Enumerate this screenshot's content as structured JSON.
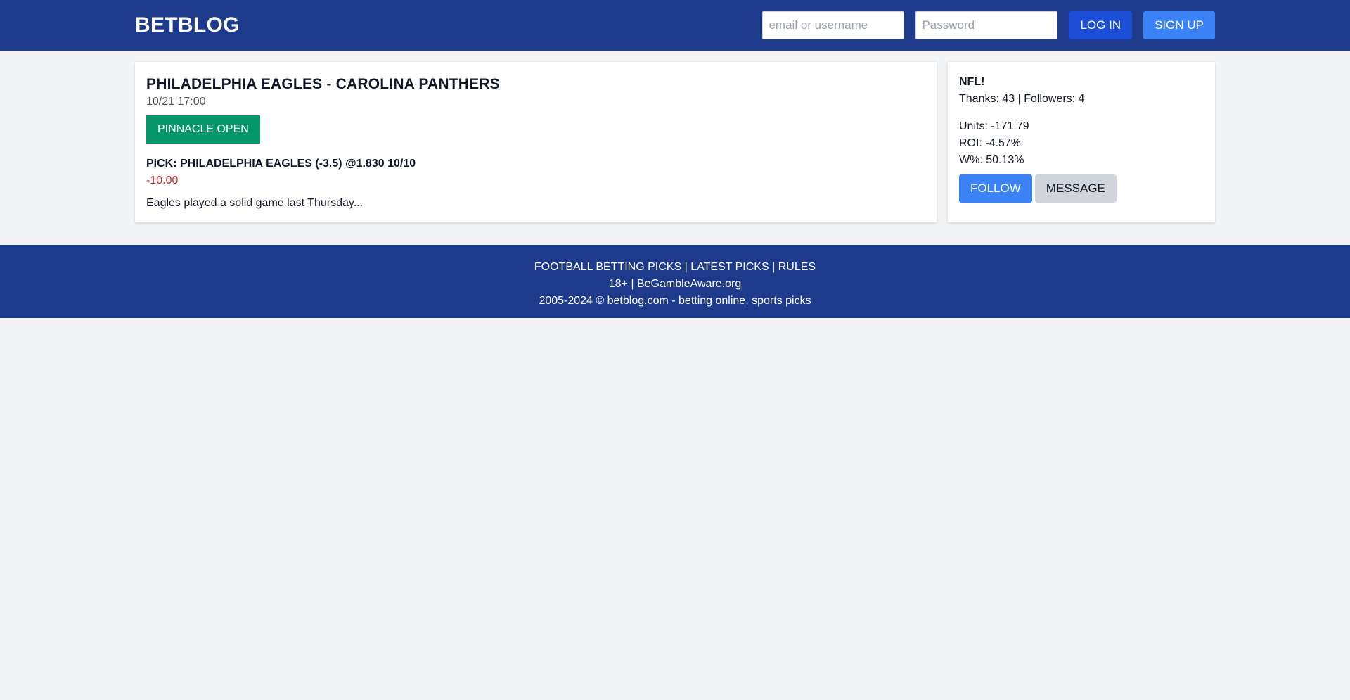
{
  "header": {
    "logo": "BETBLOG",
    "username_placeholder": "email or username",
    "password_placeholder": "Password",
    "login_label": "LOG IN",
    "signup_label": "SIGN UP"
  },
  "pick": {
    "match_title": "PHILADELPHIA EAGLES - CAROLINA PANTHERS",
    "datetime": "10/21 17:00",
    "odds_button_label": "PINNACLE OPEN",
    "pick_line": "PICK: PHILADELPHIA EAGLES (-3.5) @1.830 10/10",
    "result": "-10.00",
    "comment": "Eagles played a solid game last Thursday..."
  },
  "tipster": {
    "name": "NFL!",
    "thanks_followers": "Thanks: 43 | Followers: 4",
    "units": "Units: -171.79",
    "roi": "ROI: -4.57%",
    "win_pct": "W%: 50.13%",
    "follow_label": "FOLLOW",
    "message_label": "MESSAGE"
  },
  "footer": {
    "link_football": "FOOTBALL BETTING PICKS",
    "sep1": "|",
    "link_latest": "LATEST PICKS",
    "sep2": "|",
    "link_rules": "RULES",
    "age": "18+",
    "sep3": "|",
    "link_gambleaware": "BeGambleAware.org",
    "copyright": "2005-2024 © betblog.com - betting online, sports picks"
  },
  "colors": {
    "header_bg": "#1e3a8a",
    "login_button": "#1d4ed8",
    "signup_button": "#3b82f6",
    "pinnacle_button": "#059669",
    "negative_result": "#dc2626",
    "page_bg": "#f3f4f6"
  }
}
